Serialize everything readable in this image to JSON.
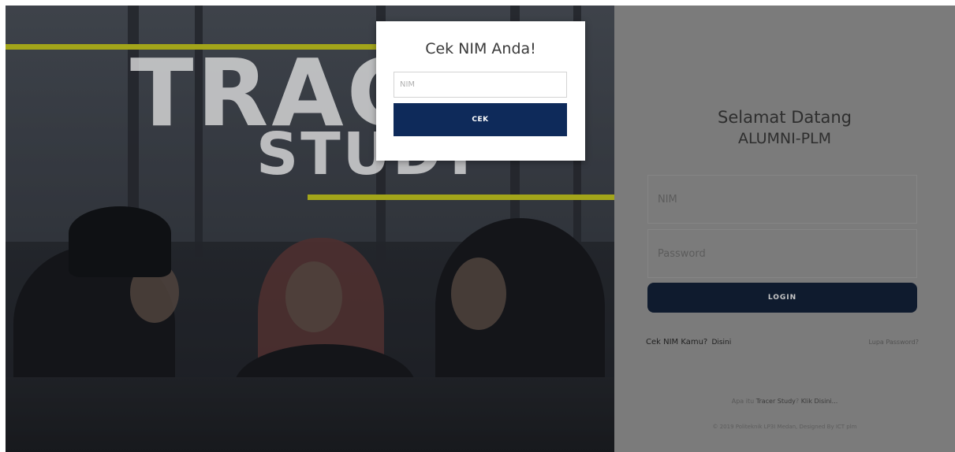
{
  "hero": {
    "title_line1": "TRAC",
    "title_line2": "STUDY",
    "accent_color": "#a3a51a"
  },
  "modal": {
    "title": "Cek NIM Anda!",
    "nim_placeholder": "NIM",
    "nim_value": "",
    "button_label": "CEK",
    "button_color": "#0e2a5a"
  },
  "login": {
    "welcome_line1": "Selamat Datang",
    "welcome_line2": "ALUMNI-PLM",
    "nim_placeholder": "NIM",
    "password_placeholder": "Password",
    "login_label": "LOGIN",
    "cek_nim_text": "Cek NIM Kamu?",
    "disini_label": "Disini",
    "lupa_password_label": "Lupa Password?",
    "footer_question_prefix": "Apa itu",
    "footer_tracer_link": "Tracer Study",
    "footer_question_sep": "?",
    "footer_klik_link": "Klik Disini...",
    "copyright": "© 2019 Politeknik LP3I Medan, Designed By ICT plm",
    "button_color": "#0f1b2e"
  }
}
